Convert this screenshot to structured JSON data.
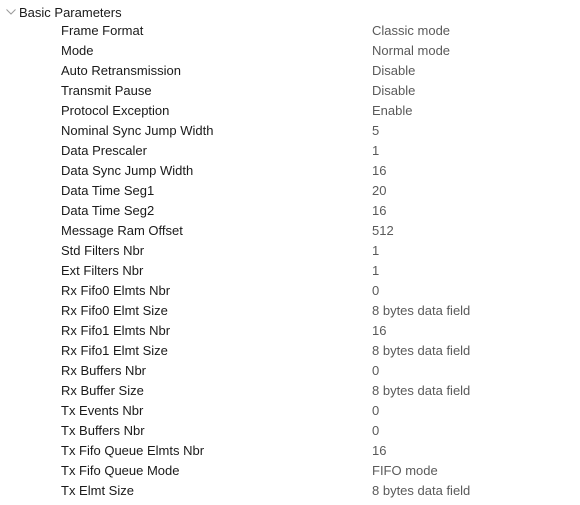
{
  "section": {
    "title": "Basic Parameters",
    "expanded": true,
    "icon": "chevron-down-icon"
  },
  "colors": {
    "label": "#1a1a1a",
    "value": "#5a5a5a",
    "chevron": "#9a9a9a"
  },
  "params": [
    {
      "label": "Frame Format",
      "value": "Classic mode"
    },
    {
      "label": "Mode",
      "value": "Normal mode"
    },
    {
      "label": "Auto Retransmission",
      "value": "Disable"
    },
    {
      "label": "Transmit Pause",
      "value": "Disable"
    },
    {
      "label": "Protocol Exception",
      "value": "Enable"
    },
    {
      "label": "Nominal Sync Jump Width",
      "value": "5"
    },
    {
      "label": "Data Prescaler",
      "value": "1"
    },
    {
      "label": "Data Sync Jump Width",
      "value": "16"
    },
    {
      "label": "Data Time Seg1",
      "value": "20"
    },
    {
      "label": "Data Time Seg2",
      "value": "16"
    },
    {
      "label": "Message Ram Offset",
      "value": "512"
    },
    {
      "label": "Std Filters Nbr",
      "value": "1"
    },
    {
      "label": "Ext Filters Nbr",
      "value": "1"
    },
    {
      "label": "Rx Fifo0 Elmts Nbr",
      "value": "0"
    },
    {
      "label": "Rx Fifo0 Elmt Size",
      "value": "8 bytes data field"
    },
    {
      "label": "Rx Fifo1 Elmts Nbr",
      "value": "16"
    },
    {
      "label": "Rx Fifo1 Elmt Size",
      "value": "8 bytes data field"
    },
    {
      "label": "Rx Buffers Nbr",
      "value": "0"
    },
    {
      "label": "Rx Buffer Size",
      "value": "8 bytes data field"
    },
    {
      "label": "Tx Events Nbr",
      "value": "0"
    },
    {
      "label": "Tx Buffers Nbr",
      "value": "0"
    },
    {
      "label": "Tx Fifo Queue Elmts Nbr",
      "value": "16"
    },
    {
      "label": "Tx Fifo Queue Mode",
      "value": "FIFO mode"
    },
    {
      "label": "Tx Elmt Size",
      "value": "8 bytes data field"
    }
  ]
}
